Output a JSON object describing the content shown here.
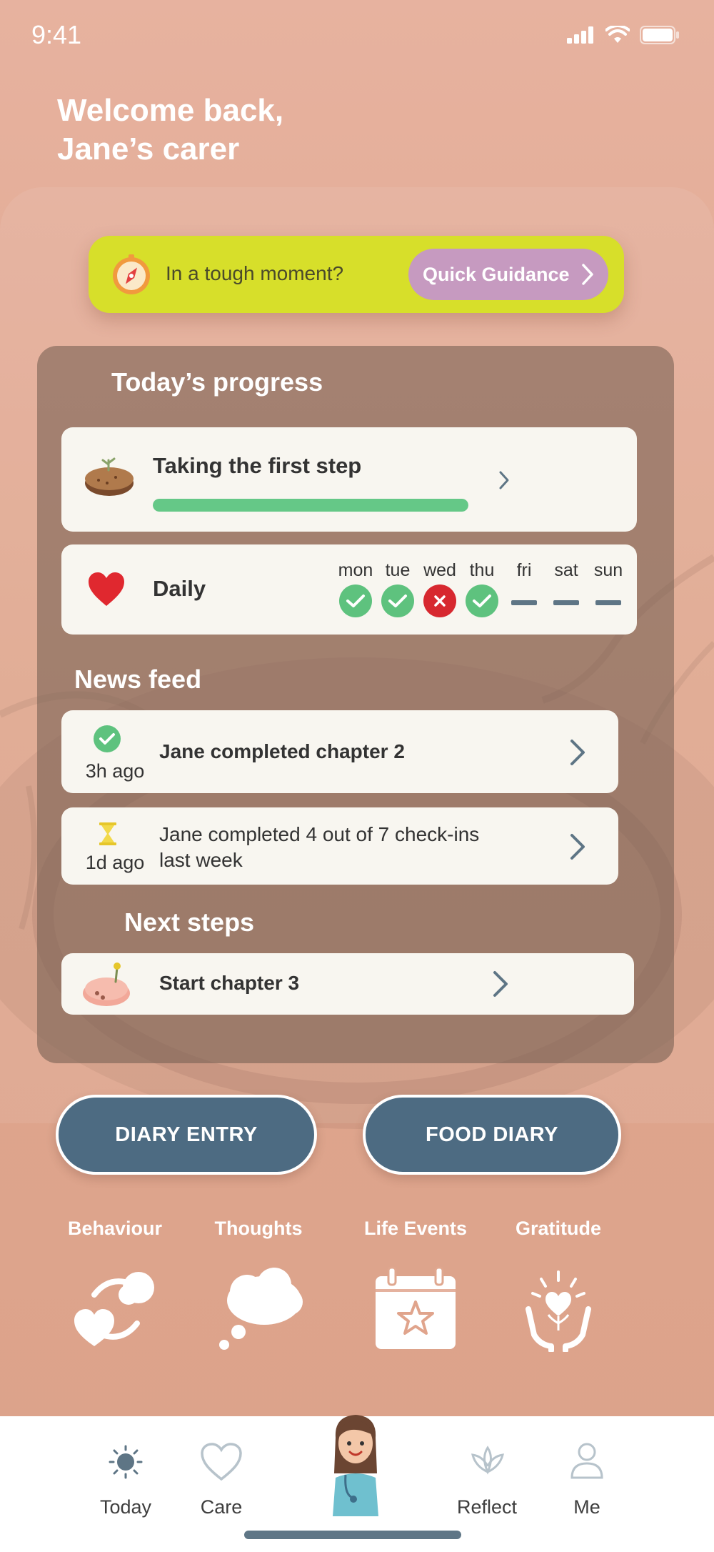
{
  "status_bar": {
    "time": "9:41"
  },
  "header": {
    "welcome_line1": "Welcome back,",
    "welcome_line2": "Jane’s carer"
  },
  "guidance": {
    "prompt": "In a tough moment?",
    "button_label": "Quick Guidance"
  },
  "progress": {
    "section_title": "Today’s progress",
    "chapter_title": "Taking the first step",
    "chapter_progress": 1.0
  },
  "daily": {
    "label": "Daily",
    "days": [
      {
        "name": "mon",
        "status": "done"
      },
      {
        "name": "tue",
        "status": "done"
      },
      {
        "name": "wed",
        "status": "missed"
      },
      {
        "name": "thu",
        "status": "done"
      },
      {
        "name": "fri",
        "status": "none"
      },
      {
        "name": "sat",
        "status": "none"
      },
      {
        "name": "sun",
        "status": "none"
      }
    ]
  },
  "news": {
    "section_title": "News feed",
    "items": [
      {
        "ago": "3h ago",
        "text": "Jane completed chapter 2",
        "icon": "check-icon"
      },
      {
        "ago": "1d ago",
        "text_line1": "Jane completed 4 out of 7 check-ins",
        "text_line2": "last week",
        "icon": "hourglass-icon"
      }
    ]
  },
  "next_steps": {
    "section_title": "Next steps",
    "item": "Start chapter 3"
  },
  "actions": {
    "diary_entry": "DIARY ENTRY",
    "food_diary": "FOOD DIARY"
  },
  "categories": [
    {
      "label": "Behaviour",
      "icon": "behaviour-icon"
    },
    {
      "label": "Thoughts",
      "icon": "thought-cloud-icon"
    },
    {
      "label": "Life Events",
      "icon": "calendar-star-icon"
    },
    {
      "label": "Gratitude",
      "icon": "gratitude-hands-icon"
    }
  ],
  "tab_bar": {
    "today": "Today",
    "care": "Care",
    "reflect": "Reflect",
    "me": "Me"
  },
  "colors": {
    "background": "#e7b29f",
    "guidance_bar": "#d7df2a",
    "guidance_button": "#c69ac0",
    "action_button": "#4d6b82",
    "success": "#5ec27e",
    "missed": "#d7282f"
  }
}
